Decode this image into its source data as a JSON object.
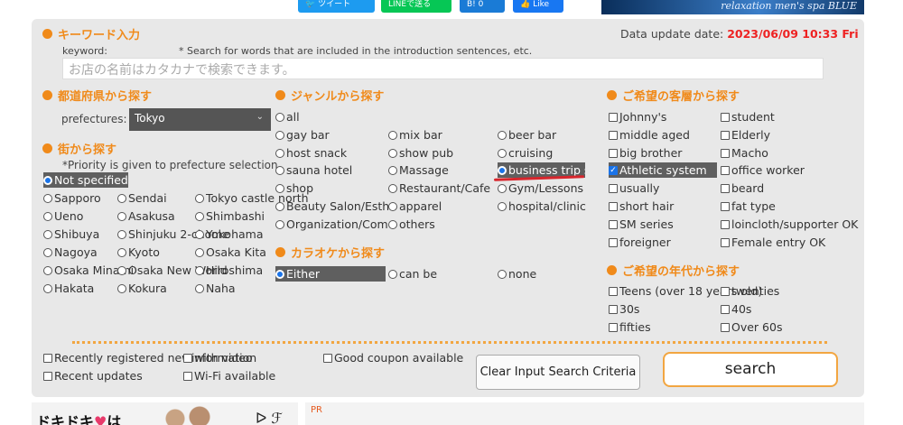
{
  "share": {
    "tweet": "ツイート",
    "line": "LINEで送る",
    "hatena": "B! 0",
    "fb": "Like",
    "banner": "relaxation men's spa BLUE"
  },
  "keyword": {
    "heading": "キーワード入力",
    "label": "keyword:",
    "hint": "* Search for words that are included in the introduction sentences, etc.",
    "placeholder": "お店の名前はカタカナで検索できます。"
  },
  "update": {
    "label": "Data update date: ",
    "value": "2023/06/09 10:33 Fri"
  },
  "prefecture": {
    "heading": "都道府県から探す",
    "label": "prefectures:",
    "selected": "Tokyo"
  },
  "town": {
    "heading": "街から探す",
    "note": "*Priority is given to prefecture selection.",
    "options": [
      "Not specified",
      "Sapporo",
      "Sendai",
      "Tokyo castle north",
      "Ueno",
      "Asakusa",
      "Shimbashi",
      "Shibuya",
      "Shinjuku 2-chome",
      "Yokohama",
      "Nagoya",
      "Kyoto",
      "Osaka Kita",
      "Osaka Minami",
      "Osaka New World",
      "Hiroshima",
      "Hakata",
      "Kokura",
      "Naha"
    ]
  },
  "genre": {
    "heading": "ジャンルから探す",
    "options": [
      "all",
      "gay bar",
      "mix bar",
      "beer bar",
      "host snack",
      "show pub",
      "cruising",
      "sauna hotel",
      "Massage",
      "business trip sales",
      "shop",
      "Restaurant/Cafe",
      "Gym/Lessons",
      "Beauty Salon/Esthe",
      "apparel",
      "hospital/clinic",
      "Organization/Community",
      "others"
    ]
  },
  "karaoke": {
    "heading": "カラオケから探す",
    "options": [
      "Either",
      "can be",
      "none"
    ]
  },
  "customer": {
    "heading": "ご希望の客層から探す",
    "options": [
      "Johnny's",
      "student",
      "middle aged",
      "Elderly",
      "big brother",
      "Macho",
      "Athletic system",
      "office worker",
      "usually",
      "beard",
      "short hair",
      "fat type",
      "SM series",
      "loincloth/supporter OK",
      "foreigner",
      "Female entry OK"
    ]
  },
  "age": {
    "heading": "ご希望の年代から探す",
    "options": [
      "Teens (over 18 years old)",
      "twenties",
      "30s",
      "40s",
      "fifties",
      "Over 60s"
    ]
  },
  "extras": {
    "options": [
      "Recently registered new",
      "with video",
      "information",
      "Good coupon available",
      "Recent updates",
      "Wi-Fi available"
    ]
  },
  "buttons": {
    "clear": "Clear Input Search Criteria",
    "search": "search"
  },
  "bottom": {
    "left_text": "ドキドキ",
    "left_text2": "は",
    "heart": "♥",
    "arrow": "ᐅ ℱ",
    "pr": "PR"
  },
  "colors": {
    "accent": "#f08a1a",
    "date": "#e22222",
    "selected_bg": "#5f5f5f",
    "radio_on": "#1a73e8"
  }
}
